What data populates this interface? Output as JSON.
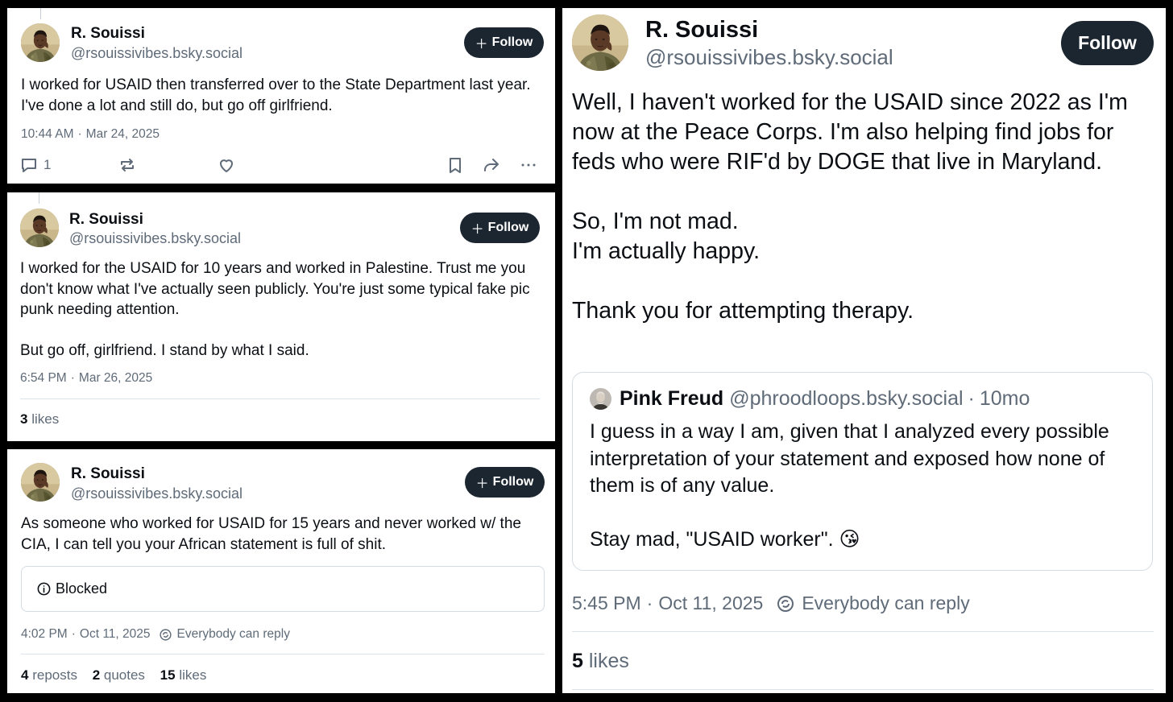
{
  "posts": [
    {
      "author_name": "R. Souissi",
      "author_handle": "@rsouissivibes.bsky.social",
      "follow_label": "Follow",
      "text": "I worked for USAID then transferred over to the State Department last year. I've done a lot and still do, but go off girlfriend.",
      "time": "10:44 AM",
      "date": "Mar 24, 2025",
      "reply_count": "1"
    },
    {
      "author_name": "R. Souissi",
      "author_handle": "@rsouissivibes.bsky.social",
      "follow_label": "Follow",
      "text": "I worked for the USAID for 10 years and worked in Palestine. Trust me you don't know what I've actually seen publicly. You're just some typical fake pic punk needing attention.\n\nBut go off, girlfriend. I stand by what I said.",
      "time": "6:54 PM",
      "date": "Mar 26, 2025",
      "likes_count": "3",
      "likes_label": "likes"
    },
    {
      "author_name": "R. Souissi",
      "author_handle": "@rsouissivibes.bsky.social",
      "follow_label": "Follow",
      "text": "As someone who worked for USAID for 15 years and never worked w/ the CIA, I can tell you your African statement is full of shit.",
      "blocked_label": "Blocked",
      "time": "4:02 PM",
      "date": "Oct 11, 2025",
      "reply_setting": "Everybody can reply",
      "reposts_count": "4",
      "reposts_label": "reposts",
      "quotes_count": "2",
      "quotes_label": "quotes",
      "likes_count": "15",
      "likes_label": "likes"
    },
    {
      "author_name": "R. Souissi",
      "author_handle": "@rsouissivibes.bsky.social",
      "follow_label": "Follow",
      "text": "Well, I haven't worked for the USAID since 2022 as I'm now at the Peace Corps. I'm also helping find jobs for feds who were RIF'd by DOGE that live in Maryland.\n\nSo, I'm not mad.\nI'm actually happy.\n\nThank you for attempting therapy.",
      "quote": {
        "author_name": "Pink Freud",
        "author_handle": "@phroodloops.bsky.social",
        "age": "10mo",
        "text": "I guess in a way I am, given that I analyzed every possible interpretation of your statement and exposed how none of them is of any value.\n\nStay mad, \"USAID worker\". 😘"
      },
      "time": "5:45 PM",
      "date": "Oct 11, 2025",
      "reply_setting": "Everybody can reply",
      "likes_count": "5",
      "likes_label": "likes"
    }
  ],
  "separator": "·",
  "colors": {
    "follow_bg": "#1c2630",
    "text_primary": "#0b0f14",
    "text_secondary": "#5f6b78",
    "divider": "#dde3ea",
    "background": "#000000"
  },
  "icons": [
    "reply-icon",
    "repost-icon",
    "like-icon",
    "bookmark-icon",
    "share-icon",
    "more-icon",
    "info-icon",
    "globe-reply-icon"
  ]
}
